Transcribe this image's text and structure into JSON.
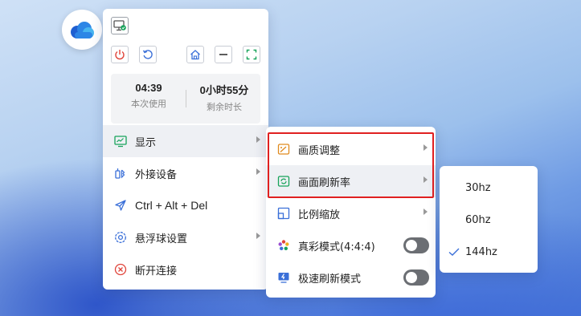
{
  "float_ball": {
    "icon": "cloud-logo-icon"
  },
  "toolbar": {
    "monitor_icon": "monitor-check-icon",
    "power_icon": "power-icon",
    "refresh_icon": "refresh-icon",
    "home_icon": "home-icon",
    "minimize_icon": "minimize-icon",
    "fullscreen_icon": "fullscreen-icon"
  },
  "session": {
    "used_value": "04:39",
    "used_label": "本次使用",
    "remaining_value": "0小时55分",
    "remaining_label": "剩余时长"
  },
  "main_menu": {
    "items": [
      {
        "label": "显示",
        "icon": "display-icon",
        "has_submenu": true
      },
      {
        "label": "外接设备",
        "icon": "external-device-icon",
        "has_submenu": true
      },
      {
        "label": "Ctrl + Alt + Del",
        "icon": "send-icon",
        "has_submenu": false
      },
      {
        "label": "悬浮球设置",
        "icon": "settings-gear-icon",
        "has_submenu": true
      },
      {
        "label": "断开连接",
        "icon": "disconnect-icon",
        "has_submenu": false
      }
    ]
  },
  "display_menu": {
    "items": [
      {
        "label": "画质调整",
        "icon": "image-quality-icon",
        "has_submenu": true
      },
      {
        "label": "画面刷新率",
        "icon": "refresh-rate-icon",
        "has_submenu": true
      },
      {
        "label": "比例缩放",
        "icon": "scale-icon",
        "has_submenu": true
      },
      {
        "label": "真彩模式(4:4:4)",
        "icon": "true-color-icon",
        "toggle": false
      },
      {
        "label": "极速刷新模式",
        "icon": "fast-refresh-icon",
        "toggle": false
      }
    ]
  },
  "refresh_rate_menu": {
    "options": [
      {
        "label": "30hz",
        "selected": false
      },
      {
        "label": "60hz",
        "selected": false
      },
      {
        "label": "144hz",
        "selected": true
      }
    ]
  },
  "colors": {
    "accent_green": "#17a35a",
    "power_red": "#e0443a",
    "highlight_red": "#e02020",
    "icon_blue": "#3a6fd8",
    "toggle_off": "#6b6e73"
  }
}
